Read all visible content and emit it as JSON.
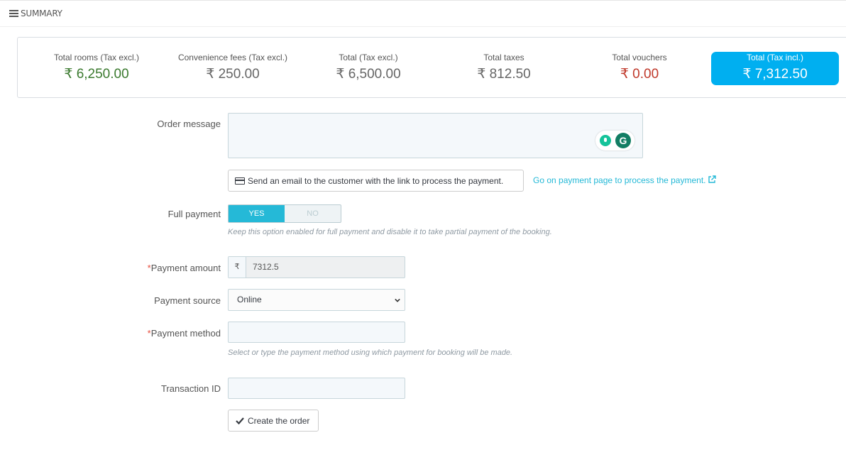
{
  "header": {
    "title": "SUMMARY",
    "icon": "list-icon"
  },
  "summary": {
    "items": [
      {
        "label": "Total rooms (Tax excl.)",
        "value": "₹ 6,250.00"
      },
      {
        "label": "Convenience fees (Tax excl.)",
        "value": "₹ 250.00"
      },
      {
        "label": "Total (Tax excl.)",
        "value": "₹ 6,500.00"
      },
      {
        "label": "Total taxes",
        "value": "₹ 812.50"
      },
      {
        "label": "Total vouchers",
        "value": "₹ 0.00"
      },
      {
        "label": "Total (Tax incl.)",
        "value": "₹ 7,312.50"
      }
    ],
    "highlight_color": "#00aff0"
  },
  "order_message": {
    "label": "Order message",
    "value": ""
  },
  "email_button": {
    "label": "Send an email to the customer with the link to process the payment.",
    "icon": "credit-card-icon"
  },
  "payment_link": {
    "label": "Go on payment page to process the payment.",
    "icon": "external-link-icon"
  },
  "full_payment": {
    "label": "Full payment",
    "yes": "YES",
    "no": "NO",
    "selected": "YES",
    "help": "Keep this option enabled for full payment and disable it to take partial payment of the booking."
  },
  "payment_amount": {
    "required_mark": "*",
    "label": "Payment amount",
    "currency": "₹",
    "value": "7312.5"
  },
  "payment_source": {
    "label": "Payment source",
    "value": "Online"
  },
  "payment_method": {
    "required_mark": "*",
    "label": "Payment method",
    "value": "",
    "help": "Select or type the payment method using which payment for booking will be made."
  },
  "transaction_id": {
    "label": "Transaction ID",
    "value": ""
  },
  "create_button": {
    "label": "Create the order",
    "icon": "checkmark-icon"
  },
  "colors": {
    "accent": "#25b9d7",
    "positive": "#3b7a2f",
    "negative": "#c0392b",
    "required": "#e74c3c"
  }
}
